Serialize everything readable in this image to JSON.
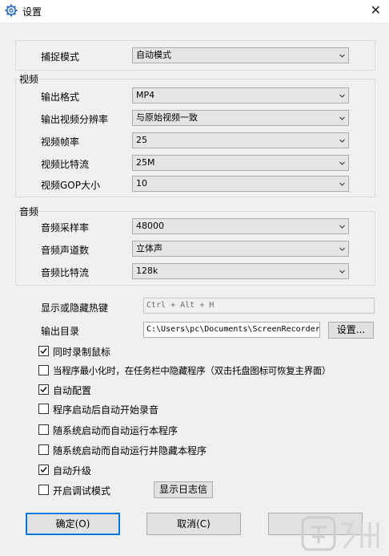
{
  "window": {
    "title": "设置",
    "close_glyph": "✕"
  },
  "capture": {
    "mode_label": "捕捉模式",
    "mode_value": "自动模式"
  },
  "video": {
    "group_title": "视频",
    "format_label": "输出格式",
    "format_value": "MP4",
    "resolution_label": "输出视频分辨率",
    "resolution_value": "与原始视频一致",
    "framerate_label": "视频帧率",
    "framerate_value": "25",
    "bitrate_label": "视频比特流",
    "bitrate_value": "25M",
    "gop_label": "视频GOP大小",
    "gop_value": "10"
  },
  "audio": {
    "group_title": "音频",
    "samplerate_label": "音频采样率",
    "samplerate_value": "48000",
    "channels_label": "音频声道数",
    "channels_value": "立体声",
    "bitrate_label": "音频比特流",
    "bitrate_value": "128k"
  },
  "hotkey": {
    "label": "显示或隐藏热键",
    "value": "Ctrl + Alt + H"
  },
  "output": {
    "label": "输出目录",
    "value": "C:\\Users\\pc\\Documents\\ScreenRecorder",
    "browse_label": "设置..."
  },
  "options": {
    "record_mouse": {
      "label": "同时录制鼠标",
      "checked": true
    },
    "hide_taskbar": {
      "label": "当程序最小化时，在任务栏中隐藏程序（双击托盘图标可恢复主界面）",
      "checked": false
    },
    "auto_config": {
      "label": "自动配置",
      "checked": true
    },
    "auto_record_audio": {
      "label": "程序启动后自动开始录音",
      "checked": false
    },
    "run_on_startup": {
      "label": "随系统启动而自动运行本程序",
      "checked": false
    },
    "run_hidden_on_startup": {
      "label": "随系统启动而自动运行并隐藏本程序",
      "checked": false
    },
    "auto_update": {
      "label": "自动升级",
      "checked": true
    },
    "debug_mode": {
      "label": "开启调试模式",
      "checked": false
    },
    "show_log_label": "显示日志信"
  },
  "footer": {
    "ok_label": "确定(O)",
    "cancel_label": "取消(C)"
  },
  "colors": {
    "accent": "#0078d7",
    "background": "#f0f0f0",
    "control": "#e5e5e5"
  },
  "icons": {
    "app": "gear-icon",
    "close": "close-icon",
    "dropdown": "chevron-down-icon",
    "check": "checkmark-icon"
  }
}
